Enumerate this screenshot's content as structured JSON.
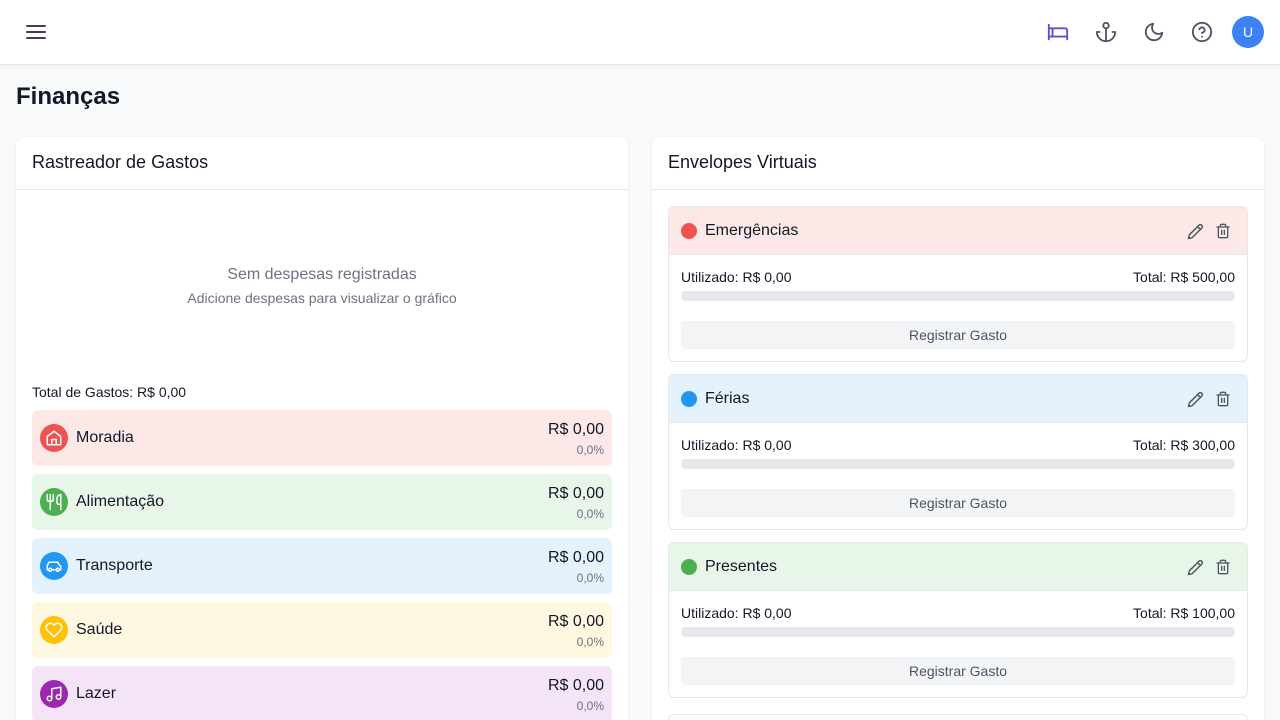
{
  "header": {
    "avatar_initial": "U",
    "icons": [
      "menu-icon",
      "bed-icon",
      "anchor-icon",
      "moon-icon",
      "help-circle-icon"
    ],
    "accent_color": "#5b4cdb"
  },
  "page": {
    "title": "Finanças"
  },
  "expenses": {
    "title": "Rastreador de Gastos",
    "empty_title": "Sem despesas registradas",
    "empty_subtitle": "Adicione despesas para visualizar o gráfico",
    "total_label": "Total de Gastos: R$ 0,00",
    "categories": [
      {
        "name": "Moradia",
        "amount": "R$ 0,00",
        "percent": "0,0%",
        "icon": "home-icon",
        "color": "#ef5350",
        "bg": "#fde8e8"
      },
      {
        "name": "Alimentação",
        "amount": "R$ 0,00",
        "percent": "0,0%",
        "icon": "utensils-icon",
        "color": "#4caf50",
        "bg": "#e8f5e9"
      },
      {
        "name": "Transporte",
        "amount": "R$ 0,00",
        "percent": "0,0%",
        "icon": "car-icon",
        "color": "#2196f3",
        "bg": "#e3f2fd"
      },
      {
        "name": "Saúde",
        "amount": "R$ 0,00",
        "percent": "0,0%",
        "icon": "heart-icon",
        "color": "#ffc107",
        "bg": "#fff8e1"
      },
      {
        "name": "Lazer",
        "amount": "R$ 0,00",
        "percent": "0,0%",
        "icon": "music-icon",
        "color": "#9c27b0",
        "bg": "#f3e5f5"
      }
    ]
  },
  "envelopes": {
    "title": "Envelopes Virtuais",
    "items": [
      {
        "name": "Emergências",
        "used": "Utilizado: R$ 0,00",
        "total": "Total: R$ 500,00",
        "progress": 0,
        "button": "Registrar Gasto",
        "color": "#ef5350",
        "bg": "#fde8e8"
      },
      {
        "name": "Férias",
        "used": "Utilizado: R$ 0,00",
        "total": "Total: R$ 300,00",
        "progress": 0,
        "button": "Registrar Gasto",
        "color": "#2196f3",
        "bg": "#e3f2fd"
      },
      {
        "name": "Presentes",
        "used": "Utilizado: R$ 0,00",
        "total": "Total: R$ 100,00",
        "progress": 0,
        "button": "Registrar Gasto",
        "color": "#4caf50",
        "bg": "#e8f5e9"
      }
    ]
  }
}
